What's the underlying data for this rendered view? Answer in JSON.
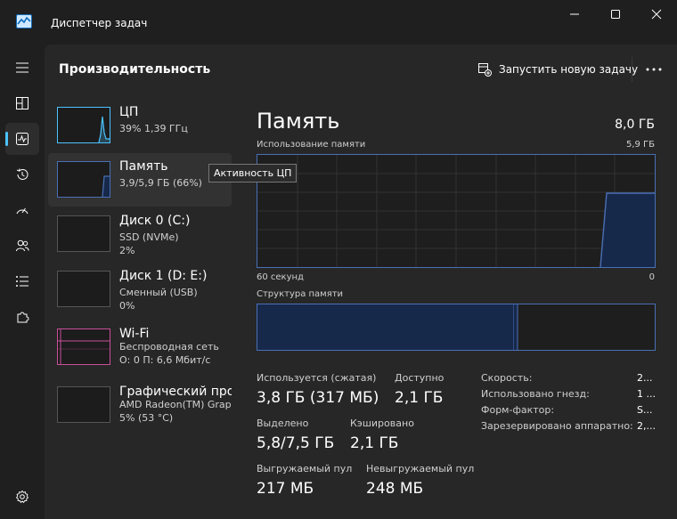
{
  "app": {
    "title": "Диспетчер задач"
  },
  "header": {
    "title": "Производительность",
    "run_task_label": "Запустить новую задачу"
  },
  "nav": {
    "items": [
      {
        "name": "Menu",
        "icon": "hamburger-icon"
      },
      {
        "name": "Processes",
        "icon": "grid-icon"
      },
      {
        "name": "Performance",
        "icon": "performance-icon",
        "active": true
      },
      {
        "name": "App history",
        "icon": "history-icon"
      },
      {
        "name": "Startup apps",
        "icon": "speedometer-icon"
      },
      {
        "name": "Users",
        "icon": "users-icon"
      },
      {
        "name": "Details",
        "icon": "list-icon"
      },
      {
        "name": "Services",
        "icon": "puzzle-icon"
      },
      {
        "name": "Settings",
        "icon": "gear-icon"
      }
    ]
  },
  "resources": [
    {
      "name": "ЦП",
      "line1": "39%  1,39 ГГц",
      "line2": "",
      "graph_color": "#4cc2ff"
    },
    {
      "name": "Память",
      "line1": "3,9/5,9 ГБ (66%)",
      "line2": "",
      "graph_color": "#4a6fb5",
      "selected": true
    },
    {
      "name": "Диск 0 (C:)",
      "line1": "SSD (NVMe)",
      "line2": "2%",
      "graph_color": "#55b855"
    },
    {
      "name": "Диск 1 (D: E:)",
      "line1": "Сменный (USB)",
      "line2": "0%",
      "graph_color": "#55b855"
    },
    {
      "name": "Wi-Fi",
      "line1": "Беспроводная сеть",
      "line2": "О: 0 П: 6,6 Мбит/с",
      "graph_color": "#c94f9a"
    },
    {
      "name": "Графический про",
      "line1": "AMD Radeon(TM) Grapl",
      "line2": "5%  (53 °C)",
      "graph_color": "#4cc2ff"
    }
  ],
  "tooltip": {
    "text": "Активность ЦП"
  },
  "memory": {
    "title": "Память",
    "total": "8,0 ГБ",
    "usage_label": "Использование памяти",
    "usage_max": "5,9 ГБ",
    "time_left": "60 секунд",
    "time_right": "0",
    "composition_label": "Структура памяти",
    "composition_in_use_fraction": 0.66,
    "stats": {
      "in_use_label": "Используется (сжатая)",
      "in_use_value": "3,8 ГБ (317 МБ)",
      "available_label": "Доступно",
      "available_value": "2,1 ГБ",
      "committed_label": "Выделено",
      "committed_value": "5,8/7,5 ГБ",
      "cached_label": "Кэшировано",
      "cached_value": "2,1 ГБ",
      "paged_label": "Выгружаемый пул",
      "paged_value": "217 МБ",
      "nonpaged_label": "Невыгружаемый пул",
      "nonpaged_value": "248 МБ"
    },
    "props": [
      {
        "label": "Скорость:",
        "value": "2..."
      },
      {
        "label": "Использовано гнезд:",
        "value": "1 ..."
      },
      {
        "label": "Форм-фактор:",
        "value": "S..."
      },
      {
        "label": "Зарезервировано аппаратно:",
        "value": "2,..."
      }
    ]
  }
}
